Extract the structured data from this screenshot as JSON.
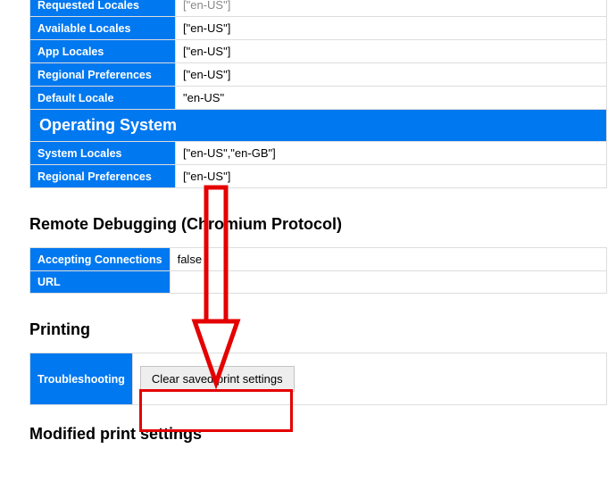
{
  "intl_table": {
    "rows": [
      {
        "label": "Requested Locales",
        "value": "[\"en-US\"]"
      },
      {
        "label": "Available Locales",
        "value": "[\"en-US\"]"
      },
      {
        "label": "App Locales",
        "value": "[\"en-US\"]"
      },
      {
        "label": "Regional Preferences",
        "value": "[\"en-US\"]"
      },
      {
        "label": "Default Locale",
        "value": "\"en-US\""
      }
    ],
    "os_header": "Operating System",
    "os_rows": [
      {
        "label": "System Locales",
        "value": "[\"en-US\",\"en-GB\"]"
      },
      {
        "label": "Regional Preferences",
        "value": "[\"en-US\"]"
      }
    ]
  },
  "remote_dbg": {
    "heading": "Remote Debugging (Chromium Protocol)",
    "rows": [
      {
        "label": "Accepting Connections",
        "value": "false"
      },
      {
        "label": "URL",
        "value": ""
      }
    ]
  },
  "printing": {
    "heading": "Printing",
    "row_label": "Troubleshooting",
    "button": "Clear saved print settings"
  },
  "modified_heading": "Modified print settings"
}
